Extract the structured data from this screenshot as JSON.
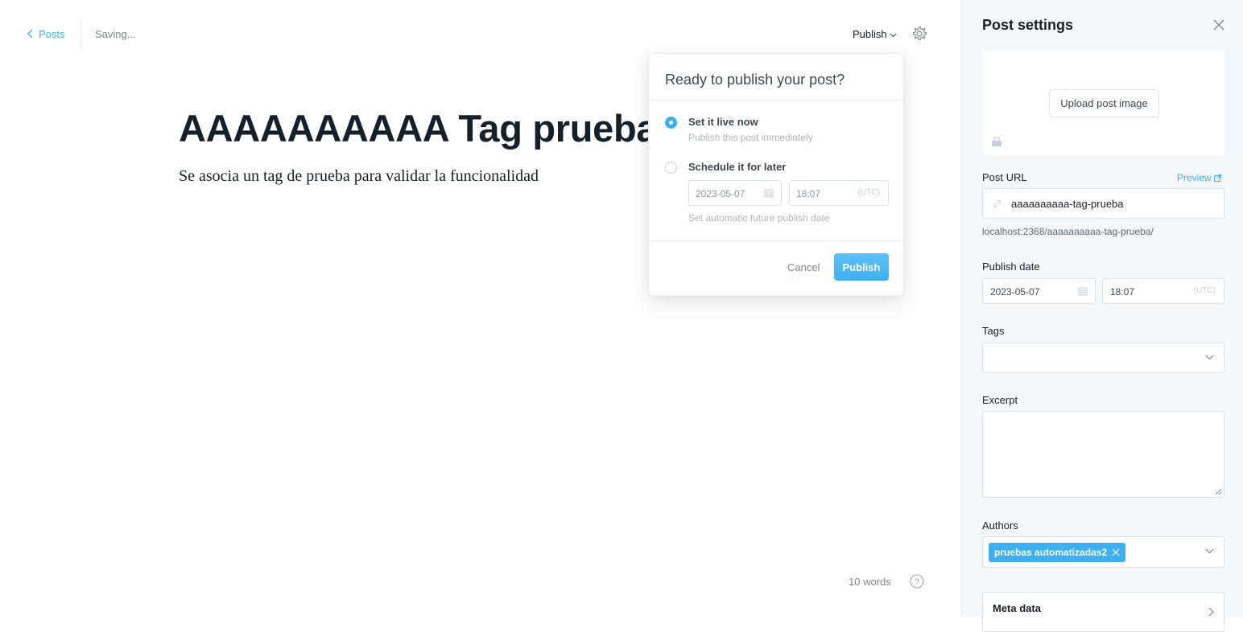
{
  "nav": {
    "back_label": "Posts",
    "status": "Saving...",
    "publish_menu": "Publish"
  },
  "post": {
    "title": "AAAAAAAAAA Tag prueba",
    "body": "Se asocia un tag de prueba para validar la funcionalidad",
    "word_count": "10 words"
  },
  "publish_popover": {
    "heading": "Ready to publish your post?",
    "options": [
      {
        "title": "Set it live now",
        "desc": "Publish this post immediately",
        "selected": true
      },
      {
        "title": "Schedule it for later",
        "selected": false
      }
    ],
    "schedule_date": "2023-05-07",
    "schedule_time": "18:07",
    "timezone": "(UTC)",
    "schedule_hint": "Set automatic future publish date",
    "cancel_label": "Cancel",
    "publish_label": "Publish"
  },
  "sidebar": {
    "title": "Post settings",
    "upload_label": "Upload post image",
    "post_url_label": "Post URL",
    "preview_label": "Preview",
    "slug": "aaaaaaaaaa-tag-prueba",
    "full_url": "localhost:2368/aaaaaaaaaa-tag-prueba/",
    "publish_date_label": "Publish date",
    "publish_date": "2023-05-07",
    "publish_time": "18:07",
    "timezone": "(UTC)",
    "tags_label": "Tags",
    "excerpt_label": "Excerpt",
    "authors_label": "Authors",
    "author_chip": "pruebas automatizadas2",
    "meta_label": "Meta data"
  },
  "colors": {
    "accent": "#3eb0ef",
    "text_dark": "#15212a",
    "sidebar_bg": "#f4f8fb"
  }
}
